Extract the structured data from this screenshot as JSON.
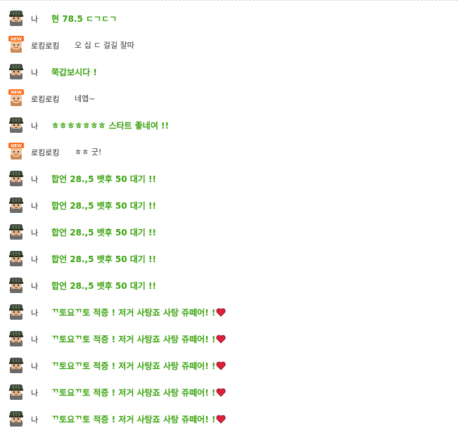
{
  "messages": [
    {
      "sender": "나",
      "type": "me",
      "text": "현 78.5 ㄷㄱㄷㄱ",
      "avatar": "soldier-avatar-icon",
      "heart": false
    },
    {
      "sender": "로킹로킹",
      "type": "other",
      "text": "오 십 ㄷ 걸길 잘따",
      "avatar": "new-badge-avatar-icon",
      "heart": false
    },
    {
      "sender": "나",
      "type": "me",
      "text": "쭉갑보시다 !",
      "avatar": "soldier-avatar-icon",
      "heart": false
    },
    {
      "sender": "로킹로킹",
      "type": "other",
      "text": "네엡~",
      "avatar": "new-badge-avatar-icon",
      "heart": false
    },
    {
      "sender": "나",
      "type": "me",
      "text": "ㅎㅎㅎㅎㅎㅎㅎ 스타트 좋네여 !!",
      "avatar": "soldier-avatar-icon",
      "heart": false
    },
    {
      "sender": "로킹로킹",
      "type": "other",
      "text": "ㅎㅎ 굿!",
      "avatar": "new-badge-avatar-icon",
      "heart": false
    },
    {
      "sender": "나",
      "type": "me",
      "text": "합언 28.,5 뱃후 50 대기 !!",
      "avatar": "soldier-avatar-icon",
      "heart": false
    },
    {
      "sender": "나",
      "type": "me",
      "text": "합언 28.,5 뱃후 50 대기 !!",
      "avatar": "soldier-avatar-icon",
      "heart": false
    },
    {
      "sender": "나",
      "type": "me",
      "text": "합언 28.,5 뱃후 50 대기 !!",
      "avatar": "soldier-avatar-icon",
      "heart": false
    },
    {
      "sender": "나",
      "type": "me",
      "text": "합언 28.,5 뱃후 50 대기 !!",
      "avatar": "soldier-avatar-icon",
      "heart": false
    },
    {
      "sender": "나",
      "type": "me",
      "text": "합언 28.,5 뱃후 50 대기 !!",
      "avatar": "soldier-avatar-icon",
      "heart": false
    },
    {
      "sender": "나",
      "type": "me",
      "text": "ᄁ토요ᄁ토 적증 ! 저거 사탕죠 사탕 쥬떼어! !",
      "avatar": "soldier-avatar-icon",
      "heart": true
    },
    {
      "sender": "나",
      "type": "me",
      "text": "ᄁ토요ᄁ토 적증 ! 저거 사탕죠 사탕 쥬떼어! !",
      "avatar": "soldier-avatar-icon",
      "heart": true
    },
    {
      "sender": "나",
      "type": "me",
      "text": "ᄁ토요ᄁ토 적증 ! 저거 사탕죠 사탕 쥬떼어! !",
      "avatar": "soldier-avatar-icon",
      "heart": true
    },
    {
      "sender": "나",
      "type": "me",
      "text": "ᄁ토요ᄁ토 적증 ! 저거 사탕죠 사탕 쥬떼어! !",
      "avatar": "soldier-avatar-icon",
      "heart": true
    },
    {
      "sender": "나",
      "type": "me",
      "text": "ᄁ토요ᄁ토 적증 ! 저거 사탕죠 사탕 쥬떼어! !",
      "avatar": "soldier-avatar-icon",
      "heart": true
    }
  ],
  "colors": {
    "my_message": "#3aa30e",
    "other_message": "#333333",
    "heart": "#e0203a"
  }
}
